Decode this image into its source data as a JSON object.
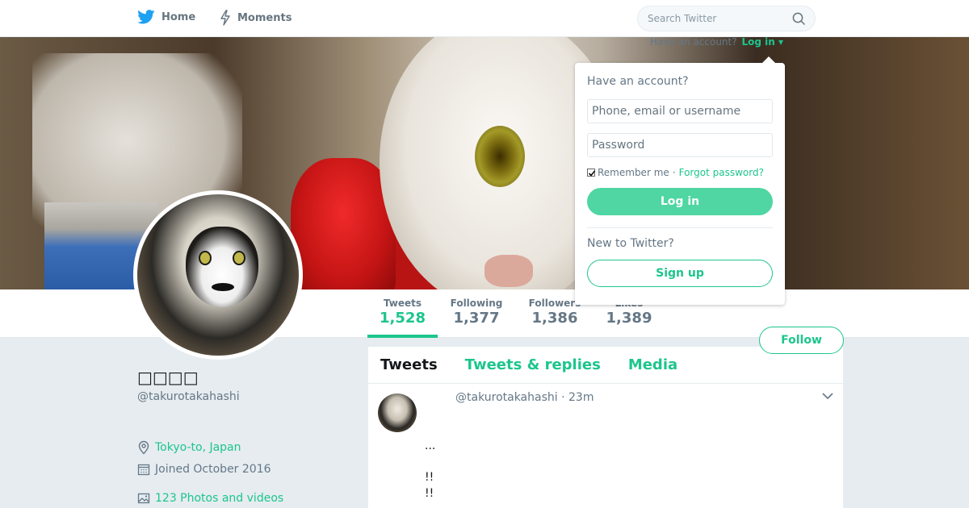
{
  "nav": {
    "home_label": "Home",
    "moments_label": "Moments",
    "search_placeholder": "Search Twitter"
  },
  "login_prompt": {
    "question": "Have an account?",
    "login_link": "Log in"
  },
  "login_dropdown": {
    "title": "Have an account?",
    "username_placeholder": "Phone, email or username",
    "password_placeholder": "Password",
    "remember_me": "Remember me",
    "separator": "·",
    "forgot_password": "Forgot password?",
    "login_button": "Log in",
    "new_to_label": "New to Twitter?",
    "signup_button": "Sign up"
  },
  "stats": [
    {
      "label": "Tweets",
      "value": "1,528",
      "active": true
    },
    {
      "label": "Following",
      "value": "1,377"
    },
    {
      "label": "Followers",
      "value": "1,386"
    },
    {
      "label": "Likes",
      "value": "1,389"
    }
  ],
  "follow_button": "Follow",
  "profile": {
    "display_name": "□□□□",
    "handle": "@takurotakahashi",
    "location": "Tokyo-to, Japan",
    "joined": "Joined October 2016",
    "photos": "123 Photos and videos"
  },
  "timeline": {
    "tabs": [
      "Tweets",
      "Tweets & replies",
      "Media"
    ],
    "tweet": {
      "header": "@takurotakahashi · 23m",
      "lines": [
        "...",
        "!!",
        "!!"
      ]
    }
  },
  "colors": {
    "accent": "#1dc58d",
    "login_button_bg": "#4fd6a3",
    "page_bg": "#e6ecf0",
    "muted_text": "#657786"
  }
}
